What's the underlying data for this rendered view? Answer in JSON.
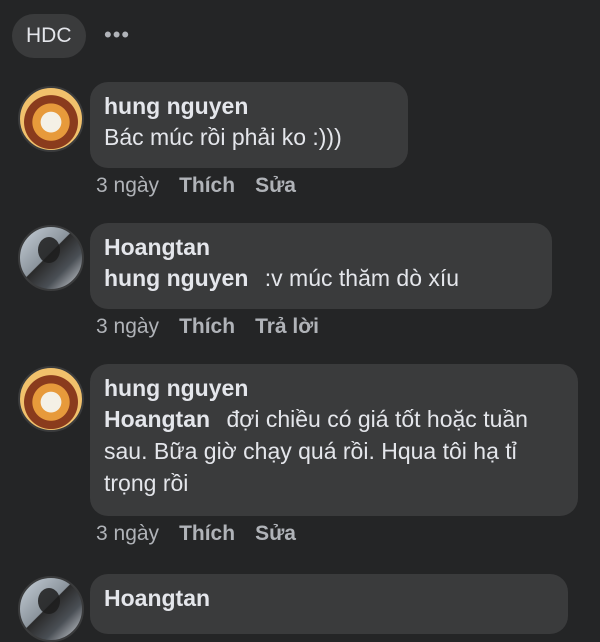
{
  "header": {
    "group_label": "HDC",
    "more_label": "•••"
  },
  "comments": [
    {
      "author": "hung nguyen",
      "mention": "",
      "text": "Bác múc rồi phải ko :)))",
      "time": "3 ngày",
      "like": "Thích",
      "action": "Sửa"
    },
    {
      "author": "Hoangtan",
      "mention": "hung nguyen",
      "text": ":v múc thăm dò xíu",
      "time": "3 ngày",
      "like": "Thích",
      "action": "Trả lời"
    },
    {
      "author": "hung nguyen",
      "mention": "Hoangtan",
      "text": "đợi chiều có giá tốt hoặc tuần sau. Bữa giờ chạy quá rồi. Hqua tôi hạ tỉ trọng rồi",
      "time": "3 ngày",
      "like": "Thích",
      "action": "Sửa"
    },
    {
      "author": "Hoangtan"
    }
  ]
}
